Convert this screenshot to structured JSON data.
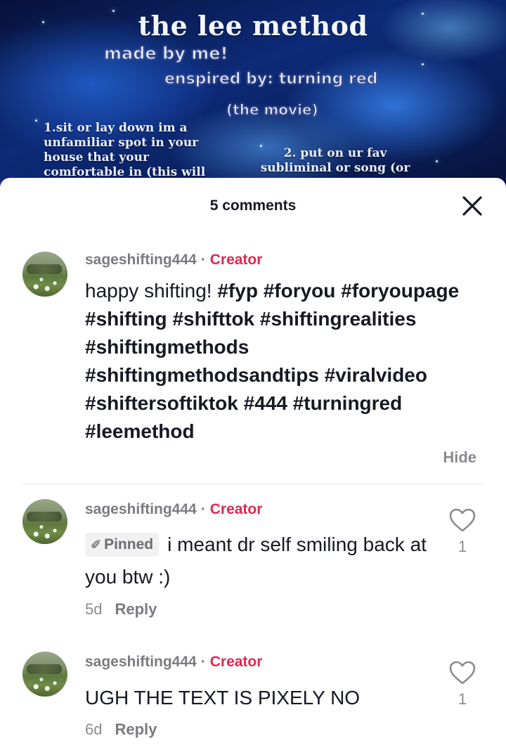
{
  "video": {
    "title": "the lee method",
    "line_made": "made by me!",
    "line_inspired": "enspired by: turning red",
    "line_movie": "(the movie)",
    "step1": "1.sit or lay down im a unfamiliar spot in your house that your comfortable in (this will",
    "step2": "2. put on ur fav subliminal or song (or"
  },
  "header": {
    "title": "5 comments",
    "close_icon": "close-icon"
  },
  "comments": [
    {
      "username": "sageshifting444",
      "separator": "·",
      "badge": "Creator",
      "text_plain": "happy shifting! ",
      "text_tags": "#fyp #foryou #foryoupage #shifting #shifttok #shiftingrealities #shiftingmethods #shiftingmethodsandtips #viralvideo #shiftersoftiktok #444 #turningred #leemethod",
      "hide_label": "Hide"
    },
    {
      "username": "sageshifting444",
      "separator": "·",
      "badge": "Creator",
      "pinned_label": "Pinned",
      "text": "i meant dr self smiling back at you btw :)",
      "age": "5d",
      "reply_label": "Reply",
      "likes": "1"
    },
    {
      "username": "sageshifting444",
      "separator": "·",
      "badge": "Creator",
      "text": "UGH THE TEXT IS PIXELY NO",
      "age": "6d",
      "reply_label": "Reply",
      "likes": "1"
    }
  ],
  "colors": {
    "creator": "#e0284f",
    "text": "#161823",
    "muted": "#8a8b91"
  }
}
